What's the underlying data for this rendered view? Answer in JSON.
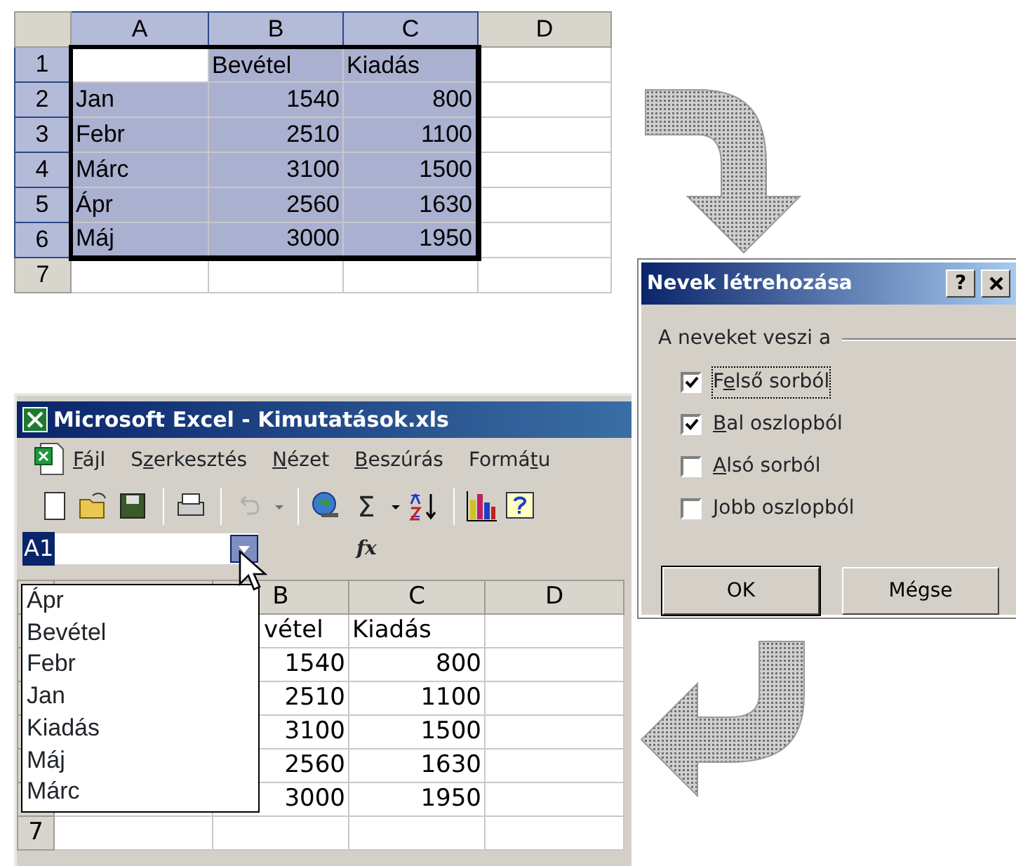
{
  "top_sheet": {
    "columns": [
      {
        "label": "A",
        "selected": true
      },
      {
        "label": "B",
        "selected": true
      },
      {
        "label": "C",
        "selected": true
      },
      {
        "label": "D",
        "selected": false
      }
    ],
    "rows": [
      {
        "header": "1",
        "selected": true,
        "cells": [
          {
            "selected": false
          },
          {
            "text": "Bevétel",
            "kind": "text",
            "selected": true
          },
          {
            "text": "Kiadás",
            "kind": "text",
            "selected": true
          },
          {
            "selected": false
          }
        ]
      },
      {
        "header": "2",
        "selected": true,
        "cells": [
          {
            "text": "Jan",
            "kind": "text",
            "selected": true
          },
          {
            "text": "1540",
            "kind": "number",
            "selected": true
          },
          {
            "text": "800",
            "kind": "number",
            "selected": true
          },
          {
            "selected": false
          }
        ]
      },
      {
        "header": "3",
        "selected": true,
        "cells": [
          {
            "text": "Febr",
            "kind": "text",
            "selected": true
          },
          {
            "text": "2510",
            "kind": "number",
            "selected": true
          },
          {
            "text": "1100",
            "kind": "number",
            "selected": true
          },
          {
            "selected": false
          }
        ]
      },
      {
        "header": "4",
        "selected": true,
        "cells": [
          {
            "text": "Márc",
            "kind": "text",
            "selected": true
          },
          {
            "text": "3100",
            "kind": "number",
            "selected": true
          },
          {
            "text": "1500",
            "kind": "number",
            "selected": true
          },
          {
            "selected": false
          }
        ]
      },
      {
        "header": "5",
        "selected": true,
        "cells": [
          {
            "text": "Ápr",
            "kind": "text",
            "selected": true
          },
          {
            "text": "2560",
            "kind": "number",
            "selected": true
          },
          {
            "text": "1630",
            "kind": "number",
            "selected": true
          },
          {
            "selected": false
          }
        ]
      },
      {
        "header": "6",
        "selected": true,
        "cells": [
          {
            "text": "Máj",
            "kind": "text",
            "selected": true
          },
          {
            "text": "3000",
            "kind": "number",
            "selected": true
          },
          {
            "text": "1950",
            "kind": "number",
            "selected": true
          },
          {
            "selected": false
          }
        ]
      },
      {
        "header": "7",
        "selected": false,
        "cells": [
          {
            "selected": false
          },
          {
            "selected": false
          },
          {
            "selected": false
          },
          {
            "selected": false
          }
        ]
      }
    ]
  },
  "dialog": {
    "title": "Nevek létrehozása",
    "help": "?",
    "group_label": "A neveket veszi a",
    "options": [
      {
        "label": {
          "before": "F",
          "key": "e",
          "after": "lső sorból"
        },
        "checked": true,
        "focused": true
      },
      {
        "label": {
          "key": "B",
          "after": "al oszlopból"
        },
        "checked": true,
        "focused": false
      },
      {
        "label": {
          "key": "A",
          "after": "lsó sorból"
        },
        "checked": false,
        "focused": false
      },
      {
        "label": {
          "key": "J",
          "after": "obb oszlopból"
        },
        "checked": false,
        "focused": false
      }
    ],
    "buttons": [
      {
        "label": "OK",
        "default": true
      },
      {
        "label": "Mégse",
        "default": false
      }
    ]
  },
  "excel": {
    "title": "Microsoft Excel - Kimutatások.xls",
    "menu": [
      {
        "key": "F",
        "after": "ájl"
      },
      {
        "before": "S",
        "key": "z",
        "after": "erkesztés"
      },
      {
        "key": "N",
        "after": "ézet"
      },
      {
        "key": "B",
        "after": "eszúrás"
      },
      {
        "before": "Formá",
        "key": "t",
        "after": "u"
      }
    ],
    "toolbar": [
      {
        "items": [
          {
            "kind": "new",
            "disabled": false
          },
          {
            "kind": "open",
            "disabled": false
          },
          {
            "kind": "save",
            "disabled": false
          }
        ]
      },
      {
        "items": [
          {
            "kind": "print",
            "disabled": false
          }
        ]
      },
      {
        "items": [
          {
            "kind": "undo",
            "disabled": true
          },
          {
            "kind": "dropdown",
            "disabled": true
          }
        ]
      },
      {
        "items": [
          {
            "kind": "hyperlink",
            "disabled": false
          },
          {
            "kind": "sum",
            "text": "Σ",
            "disabled": false
          },
          {
            "kind": "dropdown",
            "disabled": false
          },
          {
            "kind": "sort",
            "disabled": false
          }
        ]
      },
      {
        "items": [
          {
            "kind": "chart",
            "disabled": false
          },
          {
            "kind": "help",
            "disabled": false
          }
        ]
      }
    ],
    "name_box": "A1",
    "formula_label": "fx",
    "name_list": [
      "Ápr",
      "Bevétel",
      "Febr",
      "Jan",
      "Kiadás",
      "Máj",
      "Márc"
    ],
    "sheet": {
      "columns": [
        "B",
        "C",
        "D"
      ],
      "rows": [
        {
          "cells": [
            {
              "text": "vétel",
              "kind": "text"
            },
            {
              "text": "Kiadás",
              "kind": "text"
            }
          ]
        },
        {
          "cells": [
            {
              "text": "1540",
              "kind": "number"
            },
            {
              "text": "800",
              "kind": "number"
            }
          ]
        },
        {
          "cells": [
            {
              "text": "2510",
              "kind": "number"
            },
            {
              "text": "1100",
              "kind": "number"
            }
          ]
        },
        {
          "cells": [
            {
              "text": "3100",
              "kind": "number"
            },
            {
              "text": "1500",
              "kind": "number"
            }
          ]
        },
        {
          "cells": [
            {
              "text": "2560",
              "kind": "number"
            },
            {
              "text": "1630",
              "kind": "number"
            }
          ]
        },
        {
          "cells": [
            {
              "text": "3000",
              "kind": "number"
            },
            {
              "text": "1950",
              "kind": "number"
            }
          ]
        },
        {
          "header": "7",
          "cells": []
        }
      ]
    }
  }
}
